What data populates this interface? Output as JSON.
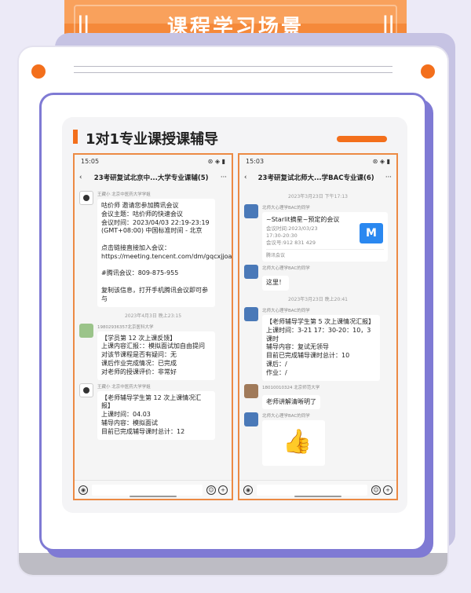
{
  "header": {
    "title": "课程学习场景",
    "bars": "||"
  },
  "section": {
    "title": "1对1专业课授课辅导"
  },
  "left_phone": {
    "time": "15:05",
    "signal": "⊛ ◈ ▮",
    "chat_title": "23考研复试北京中...大学专业课辅(5)",
    "back": "‹",
    "more": "···",
    "msg1_sender": "王藏小 北京中医药大学学姐",
    "msg1_text": "咕价师 邀请您参加腾讯会议\n会议主题：咕价师的快速会议\n会议时间：2023/04/03 22:19-23:19 (GMT+08:00) 中国标准时间 - 北京\n\n点击链接直接加入会议：\nhttps://meeting.tencent.com/dm/gqcxjjoaqVd\n\n#腾讯会议：809-875-955\n\n复制该信息，打开手机腾讯会议即可参与",
    "stamp1": "2023年4月3日 晚上23:15",
    "msg2_sender": "19802936357北京医科大学",
    "msg2_text": "【学员第 12 次上课反馈】\n上课内容汇报：：模拟面试加自由提问\n对该节课程是否有疑问：无\n课后作业完成情况：已完成\n对老师的授课评价：非常好",
    "msg3_sender": "王藏小 北京中医药大学学姐",
    "msg3_text": "【老师辅导学生第 12 次上课情况汇报】\n上课时间：04.03\n辅导内容：模拟面试\n目前已完成辅导课时总计：12"
  },
  "right_phone": {
    "time": "15:03",
    "signal": "⊛ ◈ ▮",
    "chat_title": "23考研复试北师大...学BAC专业课(6)",
    "back": "‹",
    "more": "···",
    "stamp0": "2023年3月23日 下午17:13",
    "msg1_sender": "北师大心理学BAC的同学",
    "meeting_title": "~Starlit摘星~预定的会议",
    "meeting_lines": "会议时间:2023/03/23\n17:30-20:30\n会议号:912 831 429",
    "meeting_logo": "M",
    "meeting_app": "腾讯会议",
    "msg2_sender": "北师大心理学BAC的同学",
    "msg2_text": "这里！",
    "stamp1": "2023年3月23日 晚上20:41",
    "msg3_sender": "北师大心理学BAC的同学",
    "msg3_text": "【老师辅导学生第 5 次上课情况汇报】\n上课时间：3-21 17：30-20：10，3课时\n辅导内容：复试无领导\n目前已完成辅导课时总计：10\n课后：/\n作业：/",
    "msg4_sender": "18010010324 北京师范大学",
    "msg4_text": "老师讲解清晰明了",
    "msg5_sender": "北师大心理学BAC的同学",
    "msg5_emoji": "👍"
  },
  "icons": {
    "voice": "◉",
    "emoji": "☺",
    "plus": "+"
  }
}
